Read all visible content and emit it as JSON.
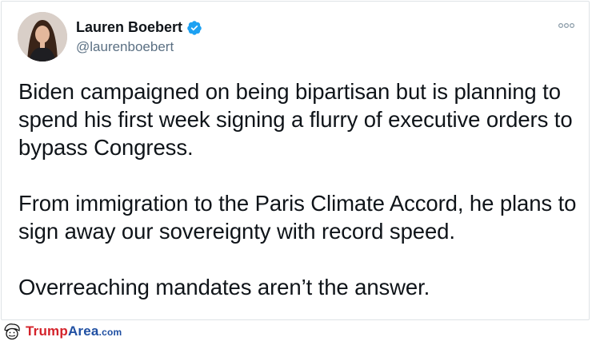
{
  "author": {
    "name": "Lauren Boebert",
    "handle": "@laurenboebert",
    "verified": true
  },
  "icons": {
    "verified": "verified-badge-icon",
    "more": "more-options-icon",
    "avatar": "profile-avatar"
  },
  "tweet": {
    "paragraphs": [
      "Biden campaigned on being bipartisan but is planning to spend his first week signing a flurry of executive orders to bypass Congress.",
      "From immigration to the Paris Climate Accord, he plans to sign away our sovereignty with record speed.",
      "Overreaching mandates aren’t the answer."
    ]
  },
  "watermark": {
    "trump": "Trump",
    "area": "Area",
    "com": ".com"
  },
  "colors": {
    "verified_blue": "#1da1f2",
    "text": "#0f1419",
    "secondary": "#5b7083",
    "brand_red": "#d4222a",
    "brand_blue": "#1f4fa2"
  }
}
